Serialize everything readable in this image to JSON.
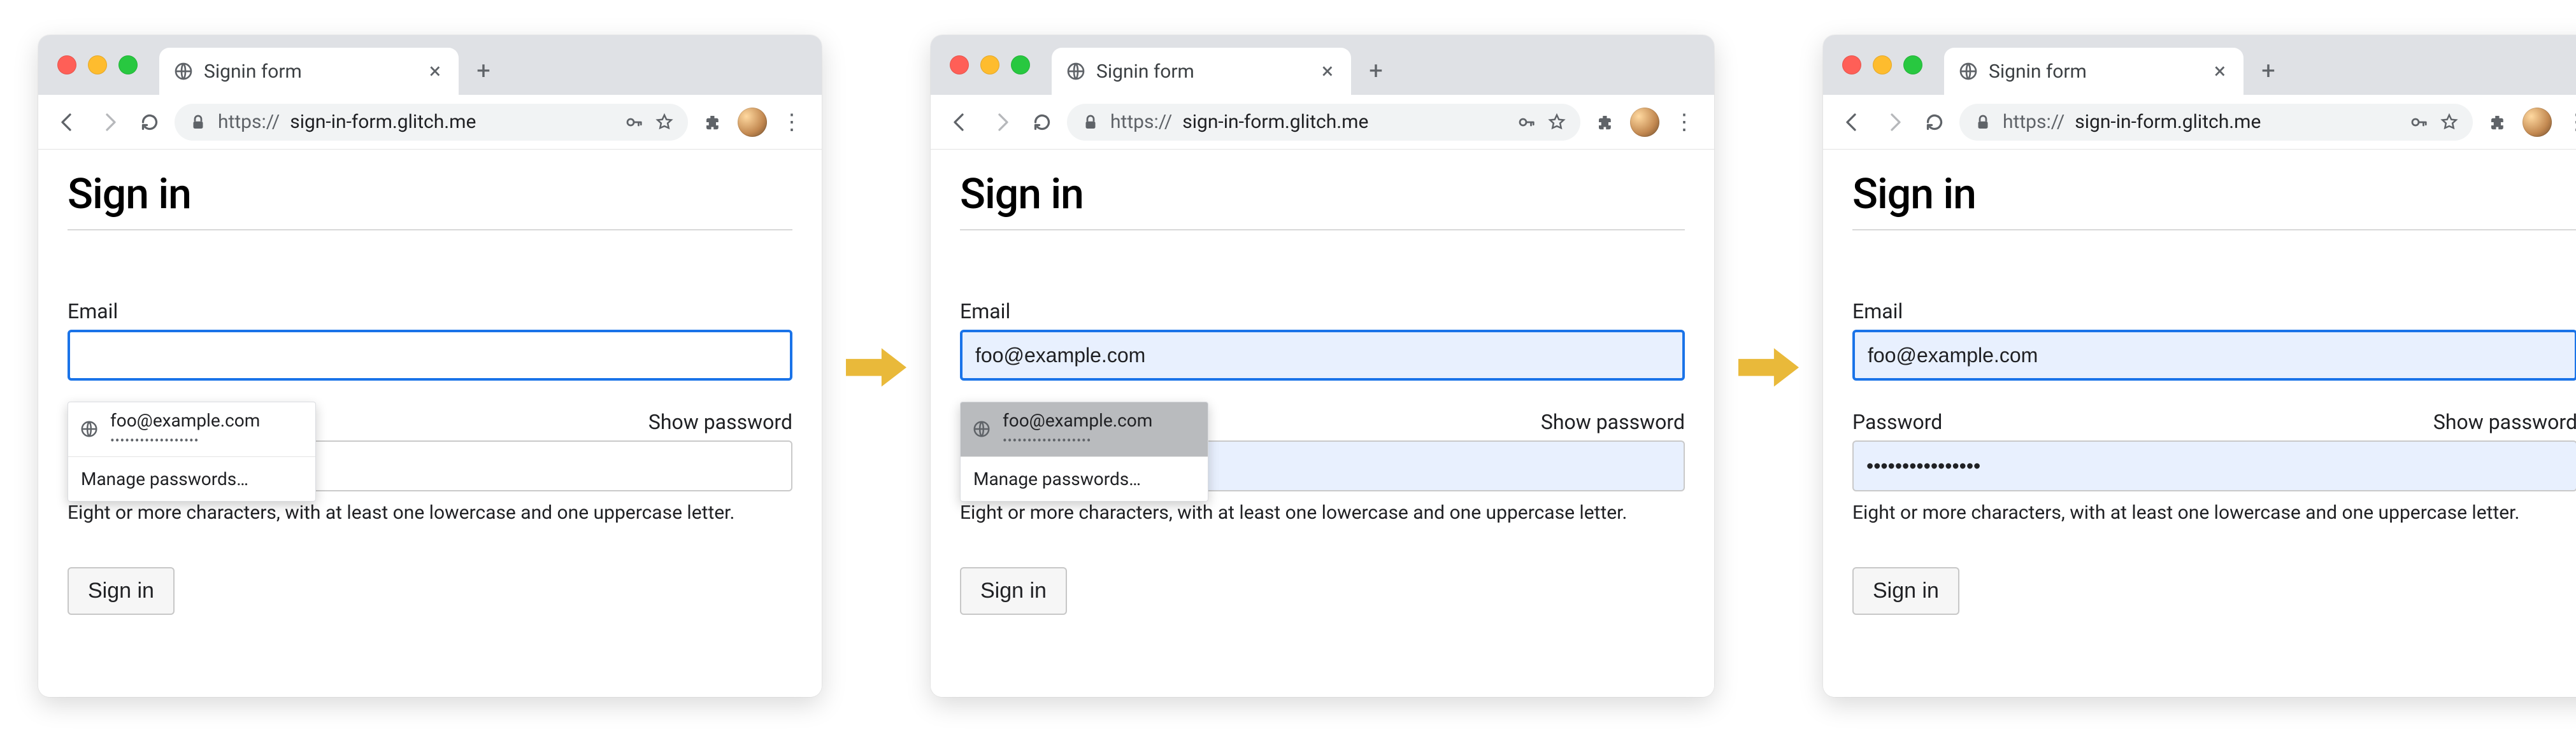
{
  "browser": {
    "tab_title": "Signin form",
    "url_scheme": "https://",
    "url_host": "sign-in-form.glitch.me",
    "new_tab_glyph": "+",
    "close_tab_glyph": "×",
    "menu_glyph": "⋮"
  },
  "page": {
    "heading": "Sign in",
    "email_label": "Email",
    "password_label": "Password",
    "show_password": "Show password",
    "hint": "Eight or more characters, with at least one lowercase and one uppercase letter.",
    "submit_label": "Sign in"
  },
  "autofill": {
    "suggestion_email": "foo@example.com",
    "suggestion_password_mask": "••••••••••••••••••",
    "manage_label": "Manage passwords…"
  },
  "frames": {
    "a": {
      "email_value": "",
      "password_value": ""
    },
    "b": {
      "email_value": "foo@example.com",
      "password_value": ""
    },
    "c": {
      "email_value": "foo@example.com",
      "password_value": "••••••••••••••••"
    }
  }
}
